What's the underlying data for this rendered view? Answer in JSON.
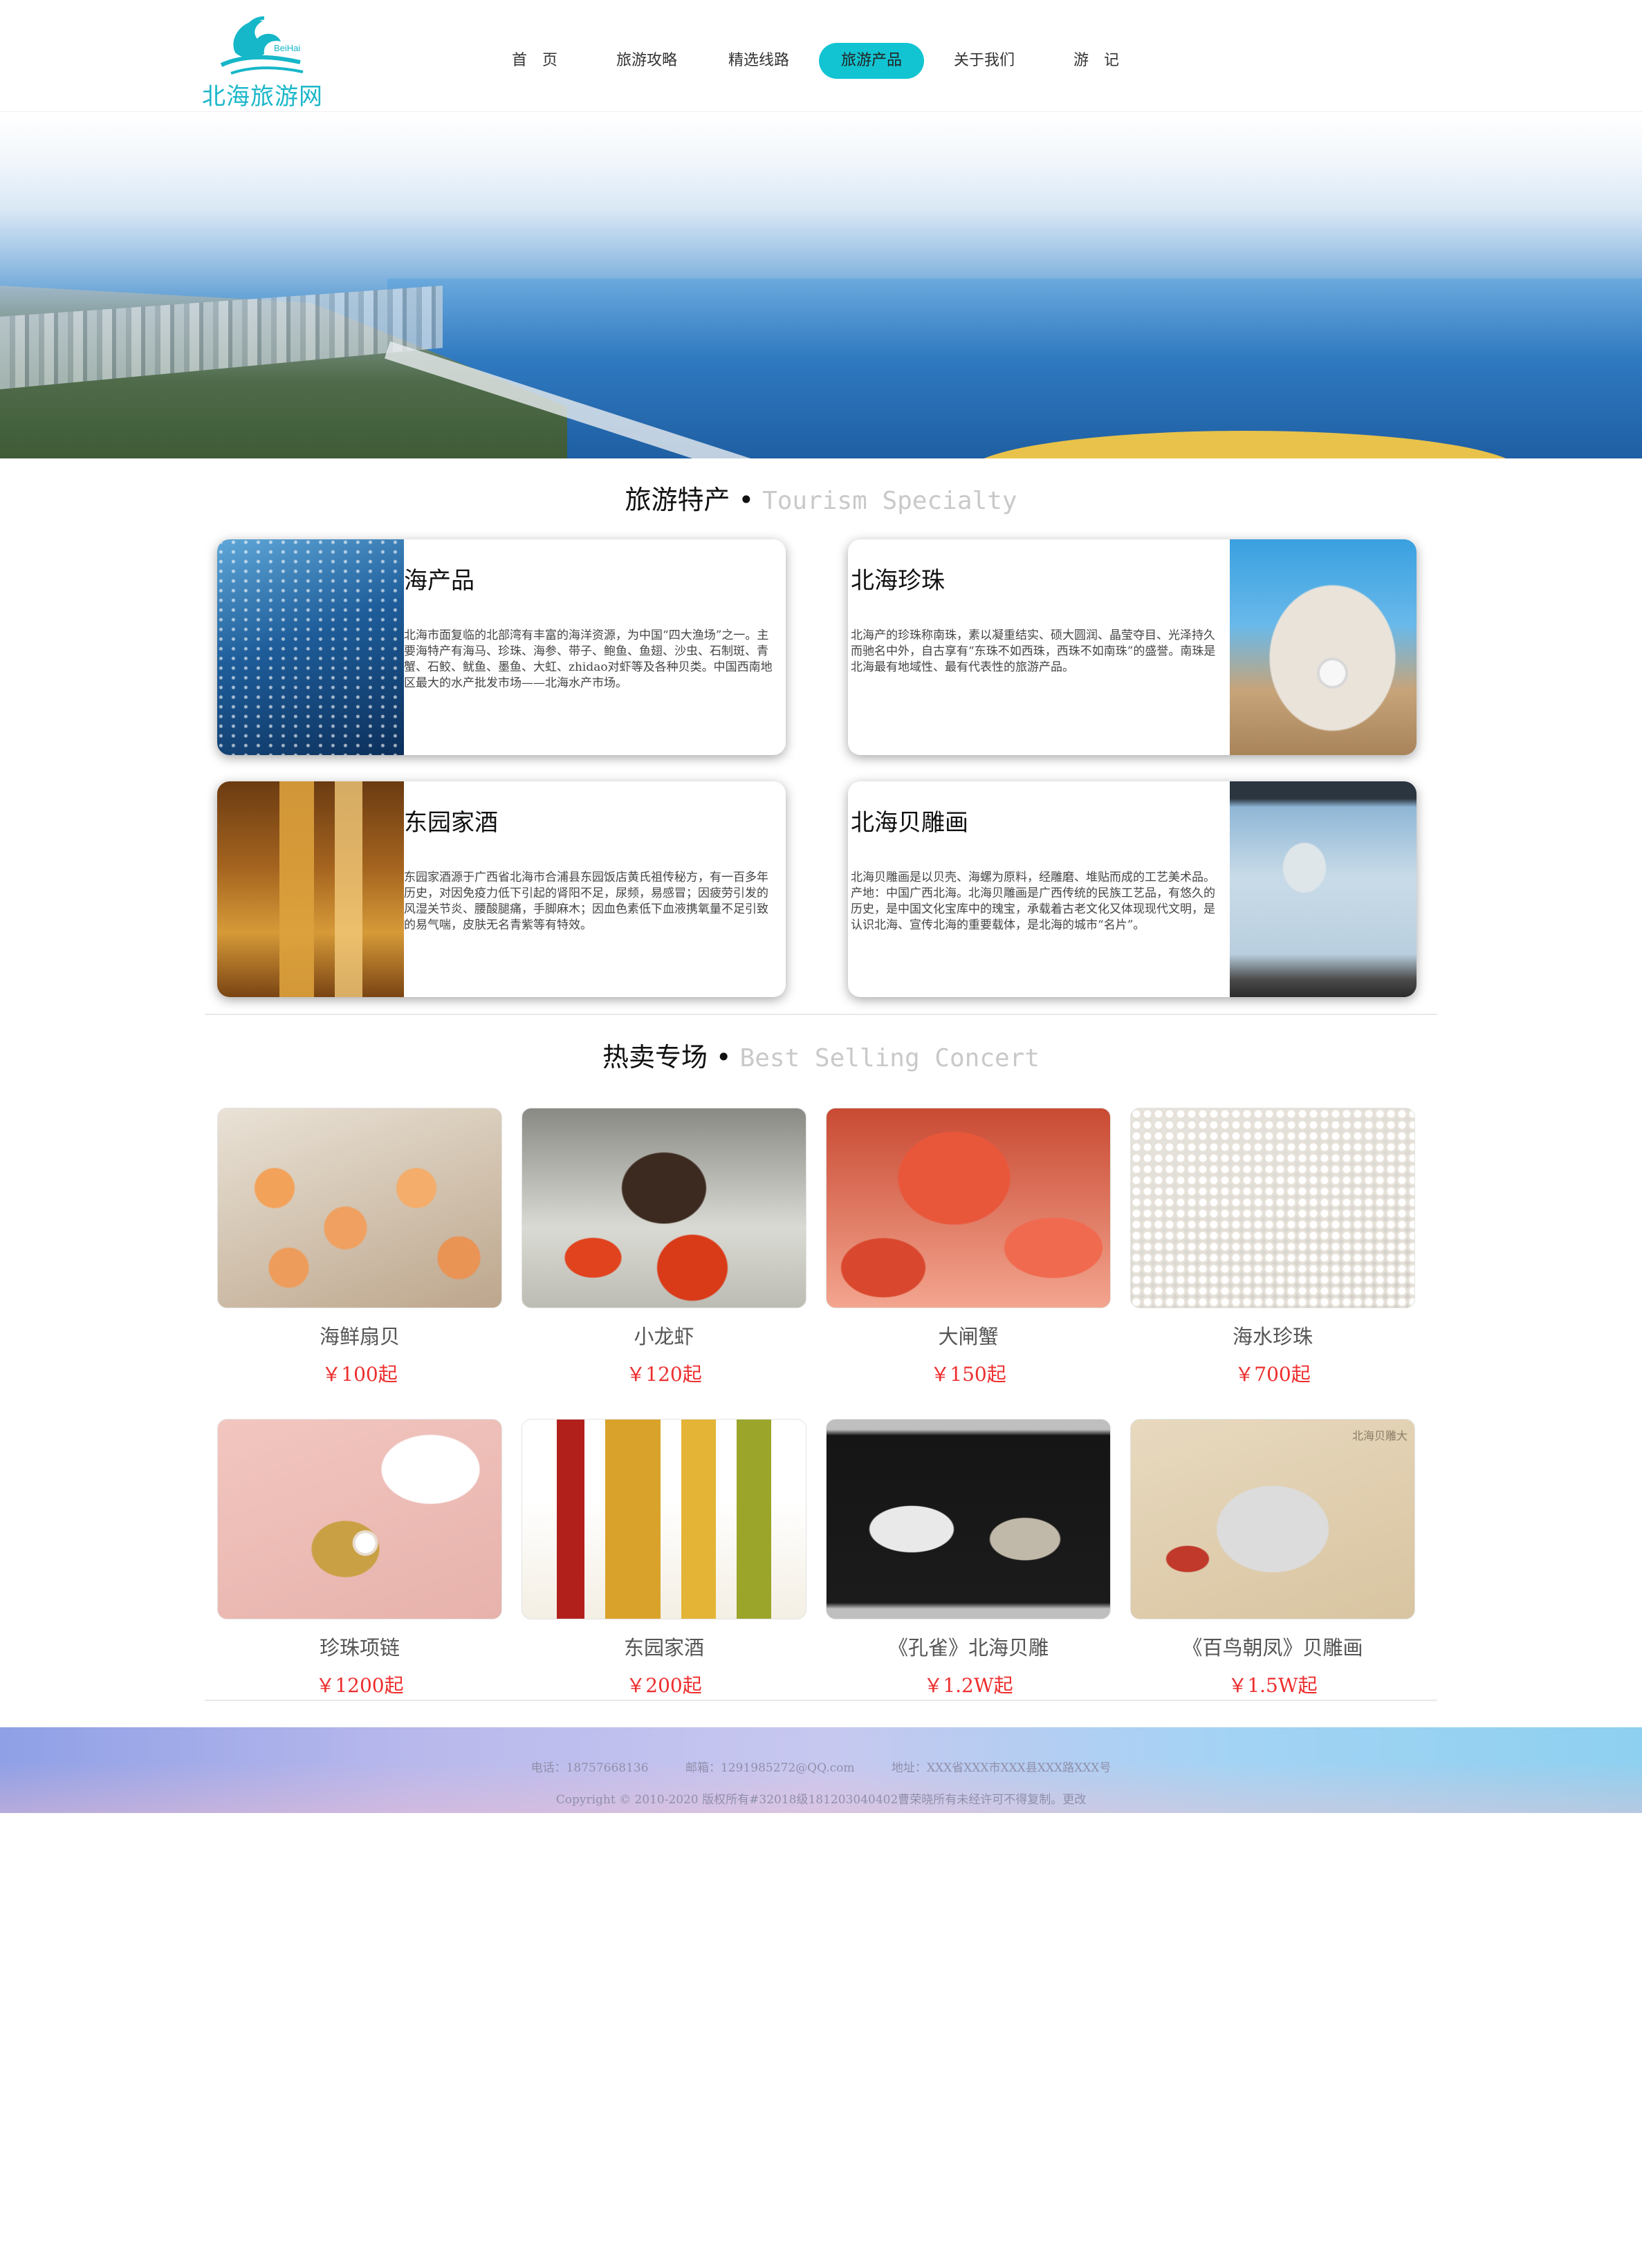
{
  "logo": {
    "text": "北海旅游网",
    "badge": "BeiHai"
  },
  "nav": {
    "items": [
      {
        "label": "首　页"
      },
      {
        "label": "旅游攻略"
      },
      {
        "label": "精选线路"
      },
      {
        "label": "旅游产品",
        "active": true
      },
      {
        "label": "关于我们"
      },
      {
        "label": "游　记"
      }
    ]
  },
  "specialty": {
    "title_cn": "旅游特产",
    "title_en": "Tourism Specialty",
    "cards": [
      {
        "title": "海产品",
        "desc": "北海市面复临的北部湾有丰富的海洋资源，为中国“四大渔场”之一。主要海特产有海马、珍珠、海参、带子、鲍鱼、鱼翅、沙虫、石制斑、青蟹、石鲛、鱿鱼、墨鱼、大虹、zhidao对虾等及各种贝类。中国西南地区最大的水产批发市场——北海水产市场。"
      },
      {
        "title": "北海珍珠",
        "desc": "北海产的珍珠称南珠，素以凝重结实、硕大圆润、晶莹夺目、光泽持久而驰名中外，自古享有“东珠不如西珠，西珠不如南珠”的盛誉。南珠是北海最有地域性、最有代表性的旅游产品。"
      },
      {
        "title": "东园家酒",
        "desc": "东园家酒源于广西省北海市合浦县东园饭店黄氏祖传秘方，有一百多年历史，对因免疫力低下引起的肾阳不足，尿频，易感冒；因疲劳引发的风湿关节炎、腰酸腿痛，手脚麻木；因血色素低下血液携氧量不足引致的易气喘，皮肤无名青紫等有特效。"
      },
      {
        "title": "北海贝雕画",
        "desc": "北海贝雕画是以贝壳、海螺为原料，经雕磨、堆贴而成的工艺美术品。产地：中国广西北海。北海贝雕画是广西传统的民族工艺品，有悠久的历史，是中国文化宝库中的瑰宝，承载着古老文化又体现现代文明，是认识北海、宣传北海的重要载体，是北海的城市“名片”。"
      }
    ]
  },
  "hot": {
    "title_cn": "热卖专场",
    "title_en": "Best Selling Concert",
    "products": [
      {
        "name": "海鲜扇贝",
        "price": "￥100起"
      },
      {
        "name": "小龙虾",
        "price": "￥120起"
      },
      {
        "name": "大闸蟹",
        "price": "￥150起"
      },
      {
        "name": "海水珍珠",
        "price": "￥700起"
      },
      {
        "name": "珍珠项链",
        "price": "￥1200起"
      },
      {
        "name": "东园家酒",
        "price": "￥200起"
      },
      {
        "name": "《孔雀》北海贝雕",
        "price": "￥1.2W起"
      },
      {
        "name": "《百鸟朝凤》贝雕画",
        "price": "￥1.5W起"
      }
    ],
    "watermark": "北海贝雕大"
  },
  "footer": {
    "phone": "电话：18757668136",
    "email": "邮箱：1291985272@QQ.com",
    "address": "地址：XXX省XXX市XXX县XXX路XXX号",
    "copyright": "Copyright © 2010-2020 版权所有#32018级181203040402曹荣晓所有未经许可不得复制。更改"
  },
  "colors": {
    "accent": "#12c4d1",
    "price": "#ee2e2e"
  }
}
